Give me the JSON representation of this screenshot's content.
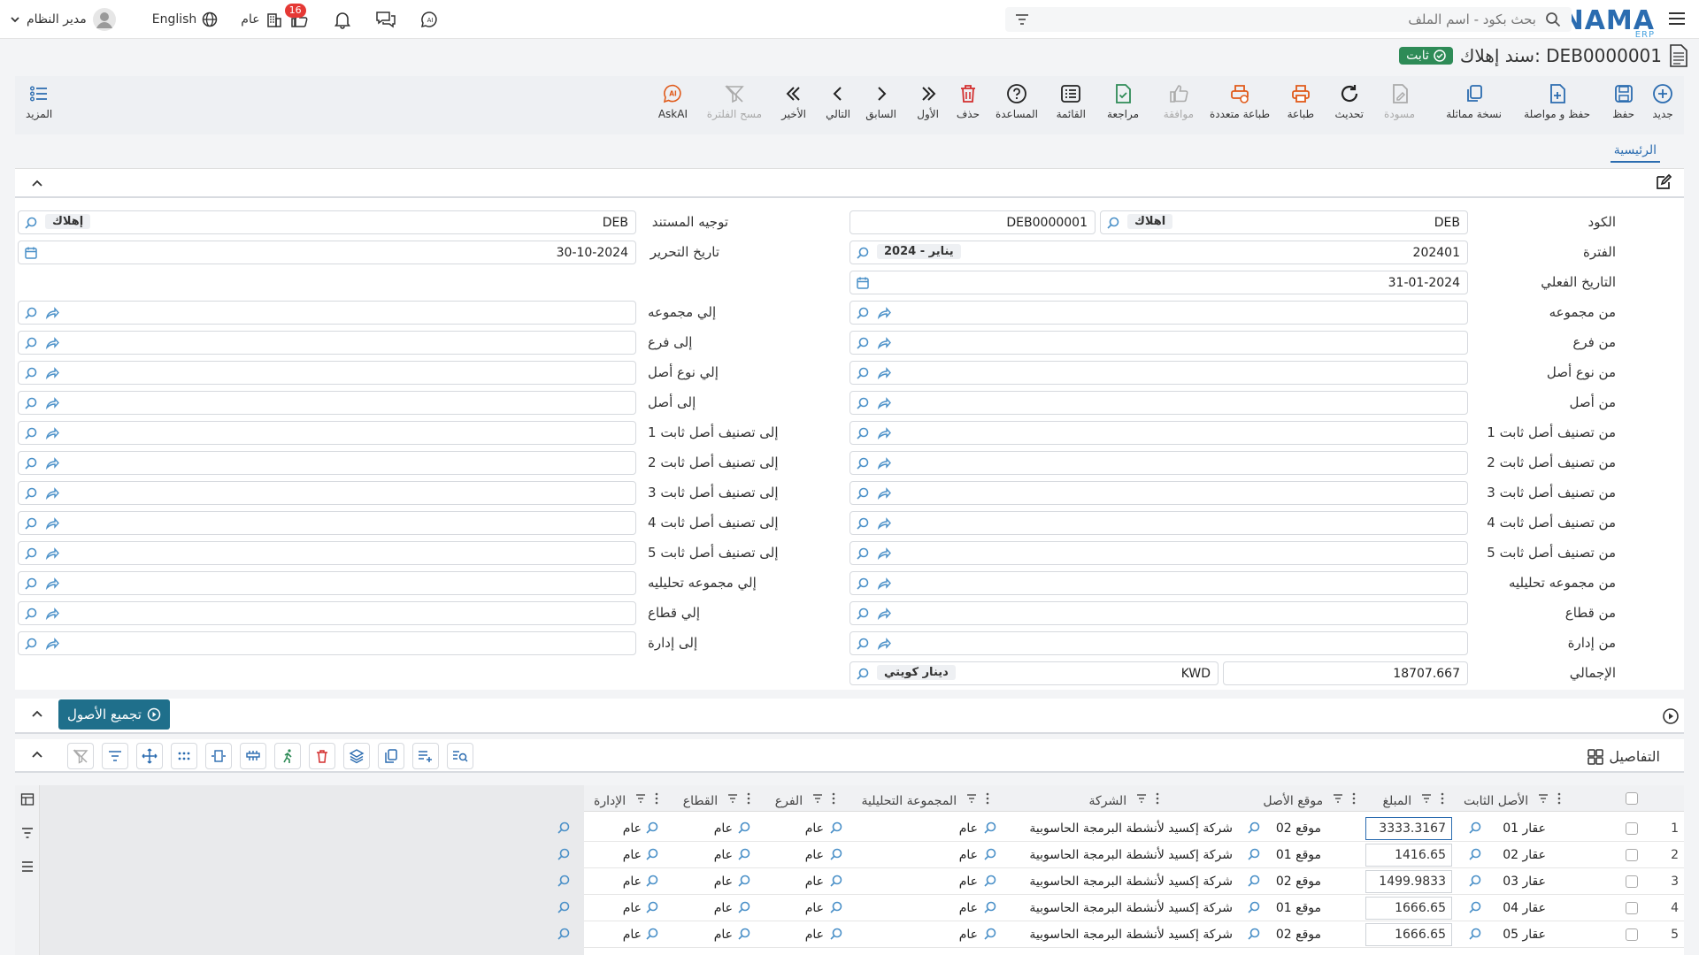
{
  "topbar": {
    "logo": "NAMA",
    "logo_sub": "ERP",
    "search_placeholder": "بحث بكود - اسم الملف",
    "user_name": "مدير النظام",
    "language": "English",
    "company": "عام",
    "notification_count": "16"
  },
  "title": {
    "text": "سند إهلاك: DEB0000001",
    "status": "ثابت"
  },
  "toolbar": {
    "new": "جديد",
    "save": "حفظ",
    "save_continue": "حفظ و مواصلة",
    "duplicate": "نسخة مماثلة",
    "draft": "مسودة",
    "refresh": "تحديث",
    "print": "طباعة",
    "multi_print": "طباعة متعددة",
    "approve": "موافقة",
    "review": "مراجعة",
    "list": "القائمة",
    "help": "المساعدة",
    "delete": "حذف",
    "first": "الأول",
    "previous": "السابق",
    "next": "التالي",
    "last": "الأخير",
    "clear_filter": "مسح الفلترة",
    "askai": "AskAI",
    "more": "المزيد"
  },
  "tabs": {
    "home": "الرئيسية"
  },
  "form": {
    "code_label": "الكود",
    "code_prefix": "DEB",
    "code_type": "اهلاك",
    "code_value": "DEB0000001",
    "period_label": "الفترة",
    "period_value": "202401",
    "period_name": "2024 - يناير",
    "actual_date_label": "التاريخ الفعلي",
    "actual_date": "31-01-2024",
    "doc_direction_label": "توجيه المستند",
    "doc_direction_code": "DEB",
    "doc_direction_name": "إهلاك",
    "edit_date_label": "تاريخ التحرير",
    "edit_date": "30-10-2024",
    "from_labels": [
      "من مجموعه",
      "من فرع",
      "من نوع أصل",
      "من أصل",
      "من تصنيف أصل ثابت 1",
      "من تصنيف أصل ثابت 2",
      "من تصنيف أصل ثابت 3",
      "من تصنيف أصل ثابت 4",
      "من تصنيف أصل ثابت 5",
      "من مجموعه تحليليه",
      "من قطاع",
      "من إدارة"
    ],
    "to_labels": [
      "إلي مجموعه",
      "إلى فرع",
      "إلي نوع أصل",
      "إلى أصل",
      "إلى تصنيف أصل ثابت 1",
      "إلى تصنيف أصل ثابت 2",
      "إلى تصنيف أصل ثابت 3",
      "إلى تصنيف أصل ثابت 4",
      "إلى تصنيف أصل ثابت 5",
      "إلي مجموعه تحليليه",
      "إلي قطاع",
      "إلى إدارة"
    ],
    "total_label": "الإجمالي",
    "total_value": "18707.667",
    "currency_code": "KWD",
    "currency_name": "دينار كويتي"
  },
  "group_assets": {
    "button": "تجميع الأصول"
  },
  "details": {
    "title": "التفاصيل",
    "columns": {
      "fixed_asset": "الأصل الثابت",
      "amount": "المبلغ",
      "asset_location": "موقع الأصل",
      "company": "الشركة",
      "analytic_group": "المجموعة التحليلية",
      "branch": "الفرع",
      "sector": "القطاع",
      "department": "الإدارة"
    },
    "rows": [
      {
        "num": "1",
        "asset": "عقار 01",
        "amount": "3333.3167",
        "location": "موقع 02",
        "company": "شركة إكسيد لأنشطة البرمجة الحاسوبية",
        "analytic": "عام",
        "branch": "عام",
        "sector": "عام",
        "department": "عام"
      },
      {
        "num": "2",
        "asset": "عقار 02",
        "amount": "1416.65",
        "location": "موقع 01",
        "company": "شركة إكسيد لأنشطة البرمجة الحاسوبية",
        "analytic": "عام",
        "branch": "عام",
        "sector": "عام",
        "department": "عام"
      },
      {
        "num": "3",
        "asset": "عقار 03",
        "amount": "1499.9833",
        "location": "موقع 02",
        "company": "شركة إكسيد لأنشطة البرمجة الحاسوبية",
        "analytic": "عام",
        "branch": "عام",
        "sector": "عام",
        "department": "عام"
      },
      {
        "num": "4",
        "asset": "عقار 04",
        "amount": "1666.65",
        "location": "موقع 01",
        "company": "شركة إكسيد لأنشطة البرمجة الحاسوبية",
        "analytic": "عام",
        "branch": "عام",
        "sector": "عام",
        "department": "عام"
      },
      {
        "num": "5",
        "asset": "عقار 05",
        "amount": "1666.65",
        "location": "موقع 02",
        "company": "شركة إكسيد لأنشطة البرمجة الحاسوبية",
        "analytic": "عام",
        "branch": "عام",
        "sector": "عام",
        "department": "عام"
      }
    ]
  }
}
